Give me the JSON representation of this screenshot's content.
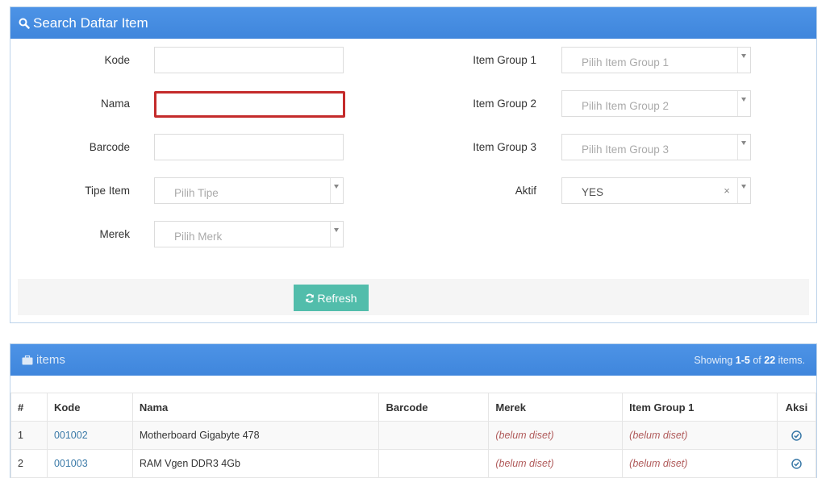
{
  "search": {
    "title": "Search Daftar Item",
    "fields": {
      "kode": {
        "label": "Kode",
        "value": ""
      },
      "nama": {
        "label": "Nama",
        "value": ""
      },
      "barcode": {
        "label": "Barcode",
        "value": ""
      },
      "tipe_item": {
        "label": "Tipe Item",
        "placeholder": "Pilih Tipe"
      },
      "merek": {
        "label": "Merek",
        "placeholder": "Pilih Merk"
      },
      "item_group_1": {
        "label": "Item Group 1",
        "placeholder": "Pilih Item Group 1"
      },
      "item_group_2": {
        "label": "Item Group 2",
        "placeholder": "Pilih Item Group 2"
      },
      "item_group_3": {
        "label": "Item Group 3",
        "placeholder": "Pilih Item Group 3"
      },
      "aktif": {
        "label": "Aktif",
        "value": "YES",
        "clear": "×"
      }
    },
    "refresh_label": "Refresh"
  },
  "items": {
    "title": "items",
    "summary_prefix": "Showing",
    "summary_range": "1-5",
    "summary_of": "of",
    "summary_total": "22",
    "summary_suffix": "items.",
    "columns": [
      "#",
      "Kode",
      "Nama",
      "Barcode",
      "Merek",
      "Item Group 1",
      "Aksi"
    ],
    "rows": [
      {
        "no": "1",
        "kode": "001002",
        "nama": "Motherboard Gigabyte 478",
        "barcode": "",
        "merek": "(belum diset)",
        "group1": "(belum diset)"
      },
      {
        "no": "2",
        "kode": "001003",
        "nama": "RAM Vgen DDR3 4Gb",
        "barcode": "",
        "merek": "(belum diset)",
        "group1": "(belum diset)"
      }
    ]
  },
  "colors": {
    "header_blue": "#4a90e2",
    "refresh_green": "#52bdab",
    "focus_red": "#c42b2b",
    "link_blue": "#3b7aa8"
  }
}
